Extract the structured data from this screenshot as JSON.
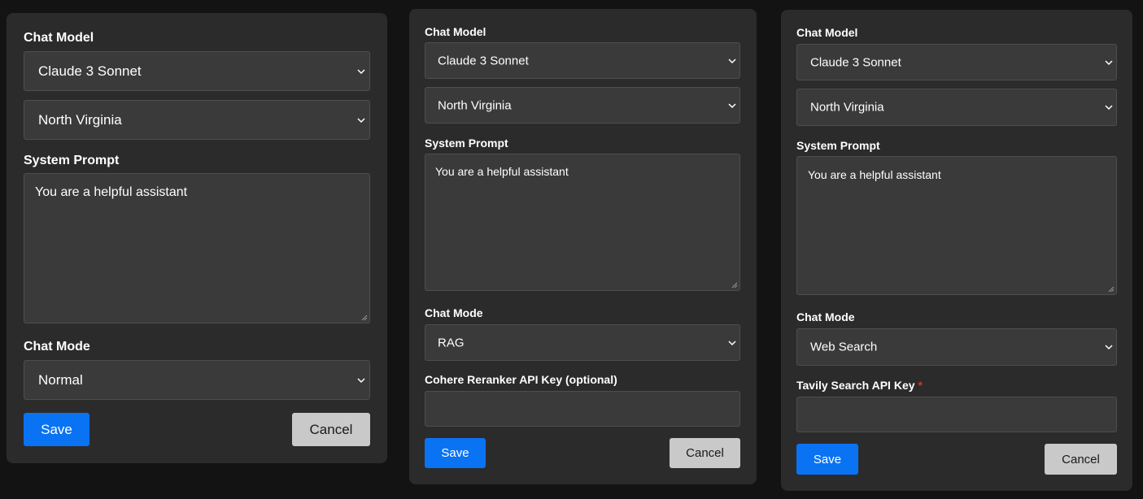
{
  "panels": [
    {
      "chat_model_label": "Chat Model",
      "model_value": "Claude 3 Sonnet",
      "region_value": "North Virginia",
      "system_prompt_label": "System Prompt",
      "system_prompt_value": "You are a helpful assistant",
      "chat_mode_label": "Chat Mode",
      "chat_mode_value": "Normal",
      "save_label": "Save",
      "cancel_label": "Cancel"
    },
    {
      "chat_model_label": "Chat Model",
      "model_value": "Claude 3 Sonnet",
      "region_value": "North Virginia",
      "system_prompt_label": "System Prompt",
      "system_prompt_value": "You are a helpful assistant",
      "chat_mode_label": "Chat Mode",
      "chat_mode_value": "RAG",
      "api_key_label": "Cohere Reranker API Key (optional)",
      "api_key_value": "",
      "save_label": "Save",
      "cancel_label": "Cancel"
    },
    {
      "chat_model_label": "Chat Model",
      "model_value": "Claude 3 Sonnet",
      "region_value": "North Virginia",
      "system_prompt_label": "System Prompt",
      "system_prompt_value": "You are a helpful assistant",
      "chat_mode_label": "Chat Mode",
      "chat_mode_value": "Web Search",
      "api_key_label": "Tavily Search API Key",
      "required_marker": "*",
      "api_key_value": "",
      "save_label": "Save",
      "cancel_label": "Cancel"
    }
  ],
  "icons": {
    "select_arrow": "chevron-down-icon",
    "resize_grip": "resize-grip-icon"
  },
  "colors": {
    "page_background": "#131313",
    "panel_background": "#2b2b2b",
    "field_background": "#3a3a3a",
    "save_button": "#0a73f4",
    "cancel_button": "#c9c9c9",
    "required_marker": "#e52a2a"
  }
}
